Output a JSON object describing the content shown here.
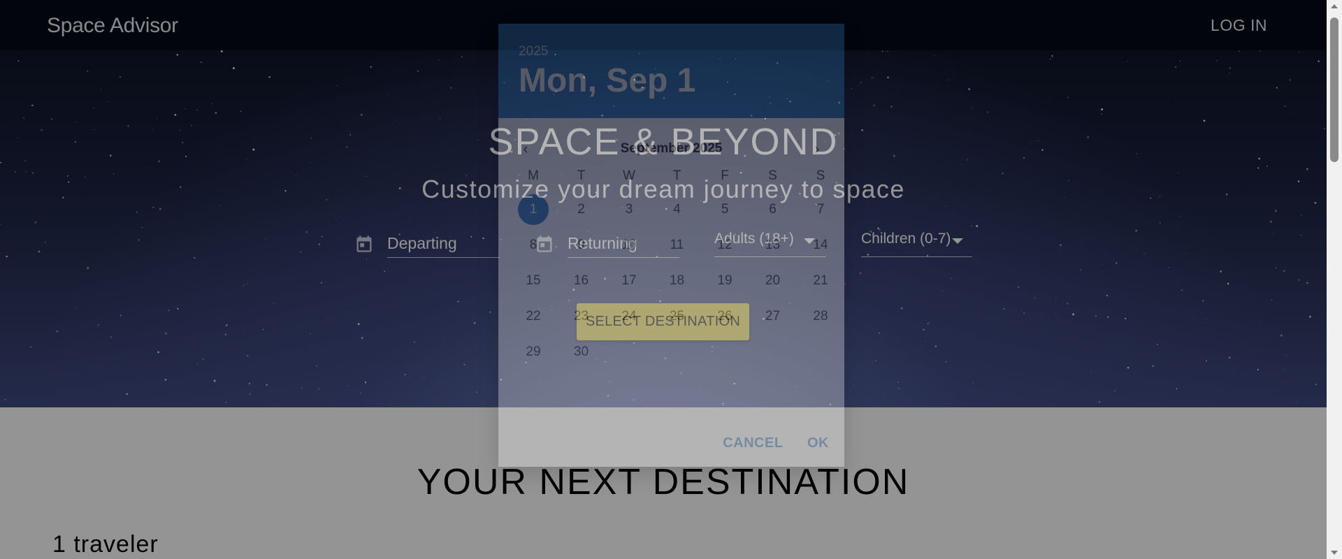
{
  "app": {
    "brand": "Space Advisor",
    "login_label": "LOG IN"
  },
  "hero": {
    "title": "SPACE & BEYOND",
    "subtitle": "Customize your dream journey to space",
    "departing_label": "Departing",
    "returning_label": "Returning",
    "adults_label": "Adults (18+)",
    "children_label": "Children (0-7)",
    "select_button": "SELECT DESTINATION"
  },
  "lower": {
    "title": "YOUR NEXT DESTINATION",
    "travelers": "1 traveler"
  },
  "datepicker": {
    "year": "2025",
    "selected_date_label": "Mon, Sep 1",
    "month_label": "September 2025",
    "weekdays": [
      "M",
      "T",
      "W",
      "T",
      "F",
      "S",
      "S"
    ],
    "days": [
      "1",
      "2",
      "3",
      "4",
      "5",
      "6",
      "7",
      "8",
      "9",
      "10",
      "11",
      "12",
      "13",
      "14",
      "15",
      "16",
      "17",
      "18",
      "19",
      "20",
      "21",
      "22",
      "23",
      "24",
      "25",
      "26",
      "27",
      "28",
      "29",
      "30"
    ],
    "selected_day": "1",
    "cancel_label": "CANCEL",
    "ok_label": "OK"
  },
  "colors": {
    "accent": "#2f79c0",
    "cta": "#f0df5a",
    "appbar": "#060a16"
  },
  "icons": {
    "calendar": "calendar-icon",
    "dropdown": "arrow-drop-down-icon"
  }
}
